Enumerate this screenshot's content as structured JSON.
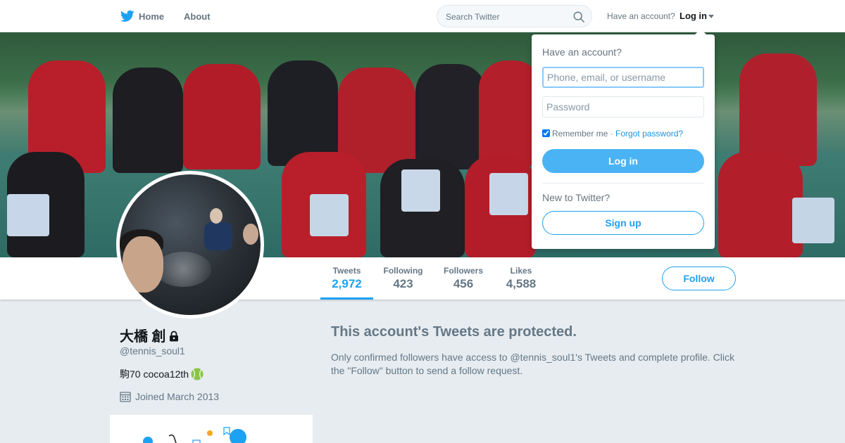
{
  "nav": {
    "home_label": "Home",
    "about_label": "About",
    "search_placeholder": "Search Twitter",
    "have_account_text": "Have an account?",
    "login_label": "Log in"
  },
  "profile": {
    "name": "大橋 創",
    "handle": "@tennis_soul1",
    "bio": "駒70 cocoa12th",
    "joined": "Joined March 2013",
    "protected": true,
    "stats": [
      {
        "label": "Tweets",
        "value": "2,972",
        "active": true
      },
      {
        "label": "Following",
        "value": "423",
        "active": false
      },
      {
        "label": "Followers",
        "value": "456",
        "active": false
      },
      {
        "label": "Likes",
        "value": "4,588",
        "active": false
      }
    ],
    "follow_label": "Follow"
  },
  "protected_notice": {
    "title": "This account's Tweets are protected.",
    "body": "Only confirmed followers have access to @tennis_soul1's Tweets and complete profile. Click the \"Follow\" button to send a follow request."
  },
  "login_dropdown": {
    "heading": "Have an account?",
    "username_placeholder": "Phone, email, or username",
    "password_placeholder": "Password",
    "remember_label": "Remember me",
    "remember_checked": true,
    "separator": "·",
    "forgot_label": "Forgot password?",
    "login_button": "Log in",
    "new_heading": "New to Twitter?",
    "signup_button": "Sign up"
  },
  "colors": {
    "brand": "#1da1f2",
    "text_secondary": "#657786",
    "background": "#e6ecf0"
  },
  "icons": [
    "twitter-bird-icon",
    "search-icon",
    "caret-down-icon",
    "lock-icon",
    "tennis-ball-icon",
    "calendar-icon"
  ]
}
